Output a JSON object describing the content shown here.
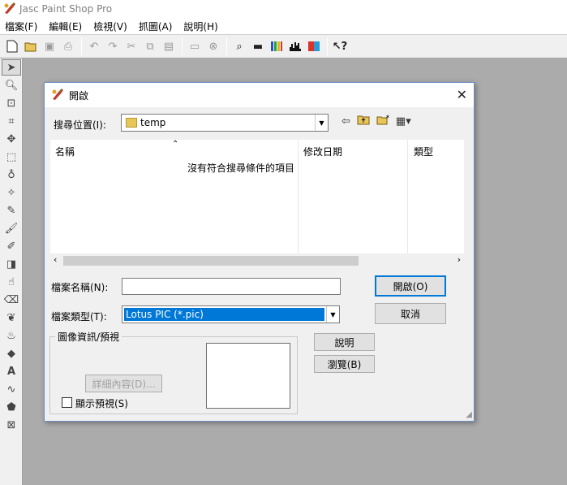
{
  "app": {
    "title": "Jasc Paint Shop Pro"
  },
  "menu": [
    "檔案(F)",
    "編輯(E)",
    "檢視(V)",
    "抓圖(A)",
    "說明(H)"
  ],
  "dialog": {
    "title": "開啟",
    "look_in_label": "搜尋位置(I):",
    "look_in_value": "temp",
    "columns": {
      "name": "名稱",
      "modified": "修改日期",
      "type": "類型"
    },
    "empty_message": "沒有符合搜尋條件的項目",
    "filename_label": "檔案名稱(N):",
    "filename_value": "",
    "filetype_label": "檔案類型(T):",
    "filetype_value": "Lotus PIC (*.pic)",
    "open_button": "開啟(O)",
    "cancel_button": "取消",
    "help_button": "說明",
    "browse_button": "瀏覽(B)",
    "info_group_label": "圖像資訊/預視",
    "details_button": "詳細內容(D)...",
    "show_preview_label": "顯示預視(S)",
    "show_preview_checked": false
  },
  "colors": {
    "selection": "#0078d7",
    "workspace": "#ababab",
    "dialog_border": "#6b8fc5"
  }
}
